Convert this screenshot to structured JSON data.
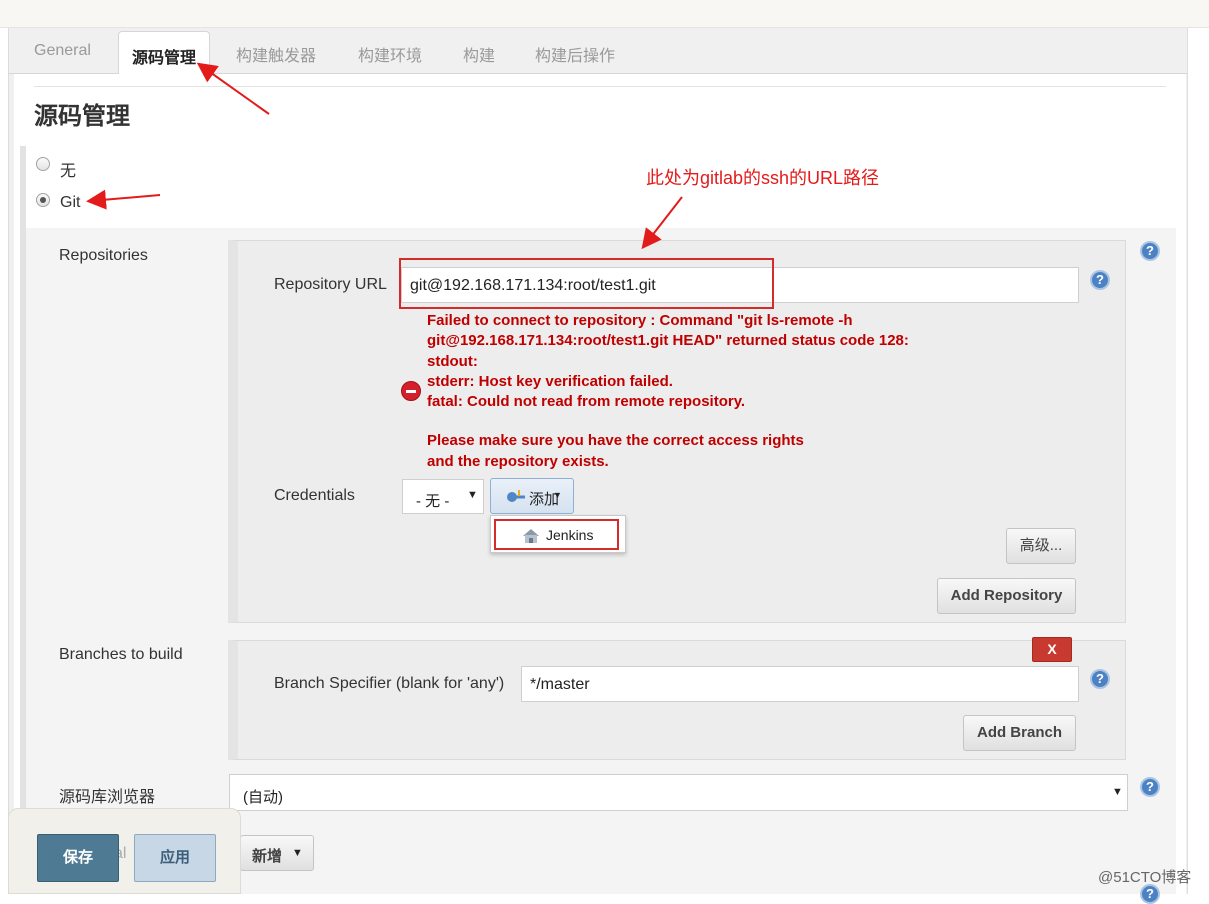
{
  "tabs": [
    "General",
    "源码管理",
    "构建触发器",
    "构建环境",
    "构建",
    "构建后操作"
  ],
  "section_title": "源码管理",
  "scm": {
    "option_none": "无",
    "option_git": "Git",
    "selected": "Git"
  },
  "repositories": {
    "label": "Repositories",
    "url_label": "Repository URL",
    "url_value": "git@192.168.171.134:root/test1.git",
    "error_lines": [
      "Failed to connect to repository : Command \"git ls-remote -h",
      "git@192.168.171.134:root/test1.git HEAD\" returned status code 128:",
      "stdout:",
      "stderr: Host key verification failed.",
      "fatal: Could not read from remote repository."
    ],
    "error_lines2": [
      "Please make sure you have the correct access rights",
      "and the repository exists."
    ],
    "credentials_label": "Credentials",
    "credentials_value": "- 无 -",
    "add_label": "添加",
    "add_menu_item": "Jenkins",
    "advanced_label": "高级...",
    "add_repository_label": "Add Repository"
  },
  "branches": {
    "label": "Branches to build",
    "delete_label": "X",
    "specifier_label": "Branch Specifier (blank for 'any')",
    "specifier_value": "*/master",
    "add_branch_label": "Add Branch"
  },
  "browser": {
    "label": "源码库浏览器",
    "value": "(自动)"
  },
  "additional": {
    "label_fragment": "al",
    "add_label": "新增"
  },
  "footer": {
    "save_label": "保存",
    "apply_label": "应用"
  },
  "annotation": {
    "text": "此处为gitlab的ssh的URL路径",
    "color": "#e31b1b"
  },
  "watermark": "@51CTO博客",
  "colors": {
    "error": "#c00000",
    "help": "#4c82c4",
    "delete": "#c83a30",
    "save": "#4f7a94"
  }
}
